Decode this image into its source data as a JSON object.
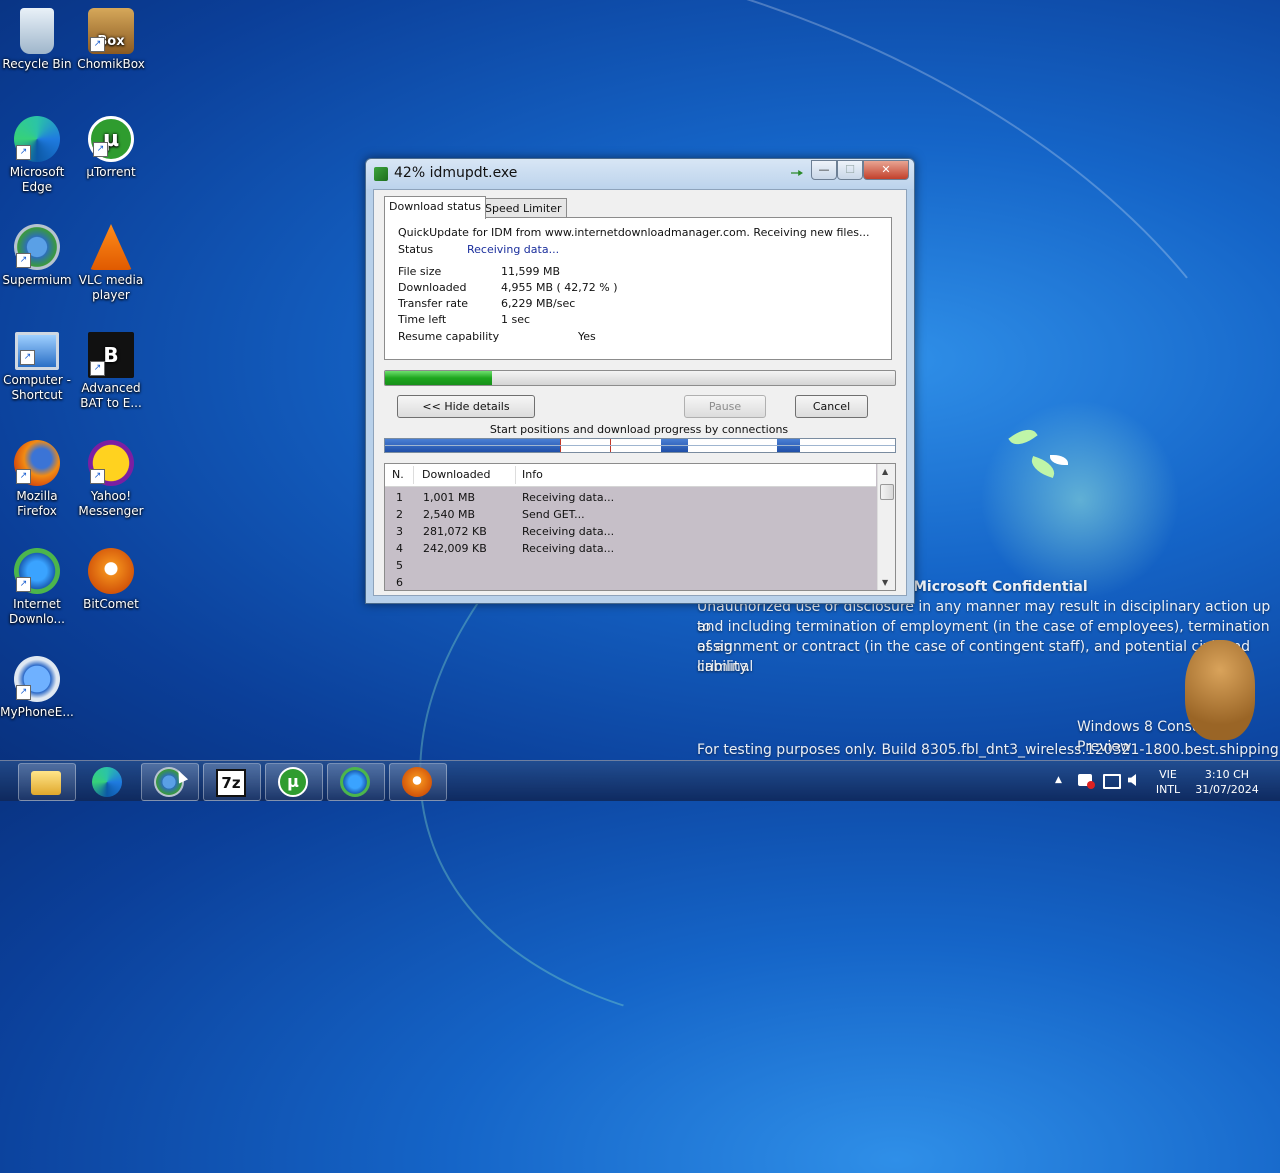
{
  "desktop": {
    "icons": [
      {
        "label": "Recycle Bin"
      },
      {
        "label": "ChomikBox"
      },
      {
        "label": "Microsoft Edge"
      },
      {
        "label": "µTorrent"
      },
      {
        "label": "Supermium"
      },
      {
        "label": "VLC media player"
      },
      {
        "label": "Computer - Shortcut"
      },
      {
        "label": "Advanced BAT to E..."
      },
      {
        "label": "Mozilla Firefox"
      },
      {
        "label": "Yahoo! Messenger"
      },
      {
        "label": "Internet Downlo..."
      },
      {
        "label": "BitComet"
      },
      {
        "label": "MyPhoneE..."
      }
    ],
    "watermark": {
      "heading": "Microsoft Confidential",
      "lines": [
        "Unauthorized use or disclosure in any manner may result in disciplinary action up to",
        "and including termination of employment (in the case of employees), termination of an",
        "assignment or contract (in the case of contingent staff), and potential civil and criminal",
        "liability."
      ],
      "product": "Windows 8 Consumer Preview",
      "build": "For testing purposes only. Build 8305.fbl_dnt3_wireless.120321-1800.best.shipping"
    }
  },
  "dialog": {
    "title": "42% idmupdt.exe",
    "tabs": [
      {
        "label": "Download status"
      },
      {
        "label": "Speed Limiter"
      }
    ],
    "message": "QuickUpdate for IDM from www.internetdownloadmanager.com. Receiving new files...",
    "status_label": "Status",
    "status_value": "Receiving data...",
    "fields": {
      "file_size": {
        "label": "File size",
        "value": "11,599  MB"
      },
      "downloaded": {
        "label": "Downloaded",
        "value": "4,955  MB  ( 42,72 % )"
      },
      "transfer_rate": {
        "label": "Transfer rate",
        "value": "6,229  MB/sec"
      },
      "time_left": {
        "label": "Time left",
        "value": "1 sec"
      },
      "resume": {
        "label": "Resume capability",
        "value": "Yes"
      }
    },
    "progress_fraction": 0.21,
    "buttons": {
      "hide_details": "<< Hide details",
      "pause": "Pause",
      "cancel": "Cancel"
    },
    "connections_caption": "Start positions and download progress by connections",
    "list": {
      "columns": [
        "N.",
        "Downloaded",
        "Info"
      ],
      "rows": [
        {
          "n": "1",
          "downloaded": "1,001  MB",
          "info": "Receiving data..."
        },
        {
          "n": "2",
          "downloaded": "2,540  MB",
          "info": "Send GET..."
        },
        {
          "n": "3",
          "downloaded": "281,072  KB",
          "info": "Receiving data..."
        },
        {
          "n": "4",
          "downloaded": "242,009  KB",
          "info": "Receiving data..."
        },
        {
          "n": "5",
          "downloaded": "",
          "info": ""
        },
        {
          "n": "6",
          "downloaded": "",
          "info": ""
        }
      ]
    }
  },
  "tray": {
    "language_top": "VIE",
    "language_bottom": "INTL",
    "time": "3:10 CH",
    "date": "31/07/2024"
  }
}
